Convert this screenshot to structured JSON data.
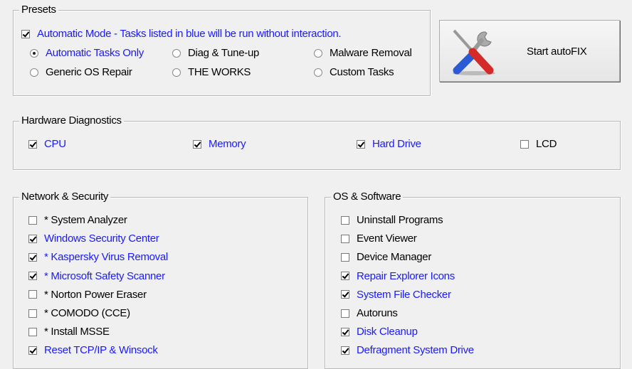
{
  "presets": {
    "title": "Presets",
    "auto_mode": {
      "label": "Automatic Mode - Tasks listed in blue will be run without interaction.",
      "checked": true
    },
    "radios": [
      {
        "label": "Automatic Tasks Only",
        "selected": true,
        "blue": true
      },
      {
        "label": "Diag & Tune-up",
        "selected": false
      },
      {
        "label": "Malware Removal",
        "selected": false
      },
      {
        "label": "Generic OS Repair",
        "selected": false
      },
      {
        "label": "THE WORKS",
        "selected": false
      },
      {
        "label": "Custom Tasks",
        "selected": false
      }
    ]
  },
  "start_button": {
    "label": "Start autoFIX",
    "icon": "tools-icon"
  },
  "hardware": {
    "title": "Hardware Diagnostics",
    "items": [
      {
        "label": "CPU",
        "checked": true
      },
      {
        "label": "Memory",
        "checked": true
      },
      {
        "label": "Hard Drive",
        "checked": true
      },
      {
        "label": "LCD",
        "checked": false
      }
    ]
  },
  "network": {
    "title": "Network & Security",
    "items": [
      {
        "label": "* System Analyzer",
        "checked": false
      },
      {
        "label": "Windows Security Center",
        "checked": true
      },
      {
        "label": "* Kaspersky Virus Removal",
        "checked": true
      },
      {
        "label": "* Microsoft Safety Scanner",
        "checked": true
      },
      {
        "label": "* Norton Power Eraser",
        "checked": false
      },
      {
        "label": "* COMODO (CCE)",
        "checked": false
      },
      {
        "label": "* Install MSSE",
        "checked": false
      },
      {
        "label": "Reset TCP/IP & Winsock",
        "checked": true
      }
    ]
  },
  "os": {
    "title": "OS & Software",
    "items": [
      {
        "label": "Uninstall Programs",
        "checked": false
      },
      {
        "label": "Event Viewer",
        "checked": false
      },
      {
        "label": "Device Manager",
        "checked": false
      },
      {
        "label": "Repair Explorer Icons",
        "checked": true
      },
      {
        "label": "System File Checker",
        "checked": true
      },
      {
        "label": "Autoruns",
        "checked": false
      },
      {
        "label": "Disk Cleanup",
        "checked": true
      },
      {
        "label": "Defragment System Drive",
        "checked": true
      }
    ]
  }
}
